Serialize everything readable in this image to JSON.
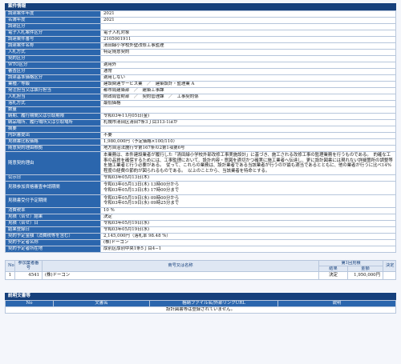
{
  "case_section": {
    "title": "案件情報",
    "rows": [
      {
        "label": "調達案件年度",
        "value": "2021"
      },
      {
        "label": "名簿年度",
        "value": "2021"
      },
      {
        "label": "調達区分",
        "value": ""
      },
      {
        "label": "電子入札案件区分",
        "value": "電子入札対象"
      },
      {
        "label": "調達案件番号",
        "value": "2105001911"
      },
      {
        "label": "調達案件名称",
        "value": "清田緑小学校外壁改修工事監理"
      },
      {
        "label": "入札方式",
        "value": "特定随意契約"
      },
      {
        "label": "契約区分",
        "value": ""
      },
      {
        "label": "WTO区分",
        "value": "適用外"
      },
      {
        "label": "審査区分",
        "value": "通常"
      },
      {
        "label": "調達基準価格区分",
        "value": "適用しない"
      },
      {
        "label": "業種／等級",
        "value": "建設関連サービス業　／　建築設計・監理業 A"
      },
      {
        "label": "発注担当又は執行担当",
        "value": "都市局建築部　／　建築工事課"
      },
      {
        "label": "入札担当",
        "value": "財政局管財部　／　契約管理課　／　工事契約係"
      },
      {
        "label": "落札方式",
        "value": "最低価格"
      },
      {
        "label": "数量",
        "value": ""
      },
      {
        "label": "納期、履行期間又は引取期限",
        "value": "令和03年11月05日(金)"
      },
      {
        "label": "納品場所、履行場所又は引取場所",
        "value": "札幌市清田区清田7条3丁目313-1ほか"
      },
      {
        "label": "摘要",
        "value": ""
      },
      {
        "label": "内訳書提出",
        "value": "不要"
      },
      {
        "label": "見積書比較価格",
        "value": "1,980,000円（予定価格×100/110）"
      },
      {
        "label": "随意契約理由根拠",
        "value": "地方自治法施行令第167条の2第1項第6号"
      },
      {
        "label": "随意契約理由",
        "value": "本業務は、本件建設業者が履行した「清田緑小学校外部改修工事実施設計」に基づき、施工される改修工事の監理業務を行うものである。　的確な工事の品質を確保するためには、工事監理において、設計内容・意図を適切かつ確実に施工業者へ伝達し、更に設計図書には現れない詳細箇所の調整等を施工業者と行う必要がある。　従って、これらの業務は、設計業者である当該業者が行うのが最も適当であるとともに、他の業者が行うに比べ14%程度の経費の節約が図られるものである。　以上のことから、当該業者を特命とする。",
        "multi": true
      },
      {
        "label": "公示日",
        "value": "令和03年05月13日(木)"
      },
      {
        "label": "見積参加資格審査申請期間",
        "value": "令和03年05月13日(木) 13時00分から\n令和03年05月13日(木) 17時00分まで",
        "multi": true
      },
      {
        "label": "見積書受付予定期間",
        "value": "令和03年05月19日(水) 09時00分から\n令和03年05月19日(水) 09時25分まで",
        "multi": true
      },
      {
        "label": "消費税率",
        "value": "10 %"
      },
      {
        "label": "見積（合せ）結果",
        "value": "決定"
      },
      {
        "label": "見積（合せ）日",
        "value": "令和03年05月19日(水)"
      },
      {
        "label": "結果登録日",
        "value": "令和03年05月19日(水)"
      },
      {
        "label": "契約予定金額（消費税等を含む）",
        "value": "2,145,000円（落札率 98.48 %）"
      },
      {
        "label": "契約予定者名称",
        "value": "(株)ドーコン"
      },
      {
        "label": "契約予定者所在地",
        "value": "厚別区厚別中央1条5丁目4−1"
      }
    ]
  },
  "bid_table": {
    "headers": {
      "no": "No",
      "reg_no": "参加業者番号",
      "name": "商号又は名称",
      "round": "第1回見積",
      "result": "結果",
      "amount": "金額",
      "decision": "決定"
    },
    "rows": [
      {
        "no": "1",
        "reg_no": "4541",
        "name": "(株)ドーコン",
        "result": "決定",
        "amount": "1,950,000円",
        "decision": ""
      }
    ]
  },
  "docs_section": {
    "title": "説明文書等",
    "headers": {
      "no": "No",
      "name": "文書名",
      "file": "格納ファイル名/外部リンクURL",
      "desc": "説明"
    },
    "empty_text": "設計図書等は登録されていません。"
  }
}
